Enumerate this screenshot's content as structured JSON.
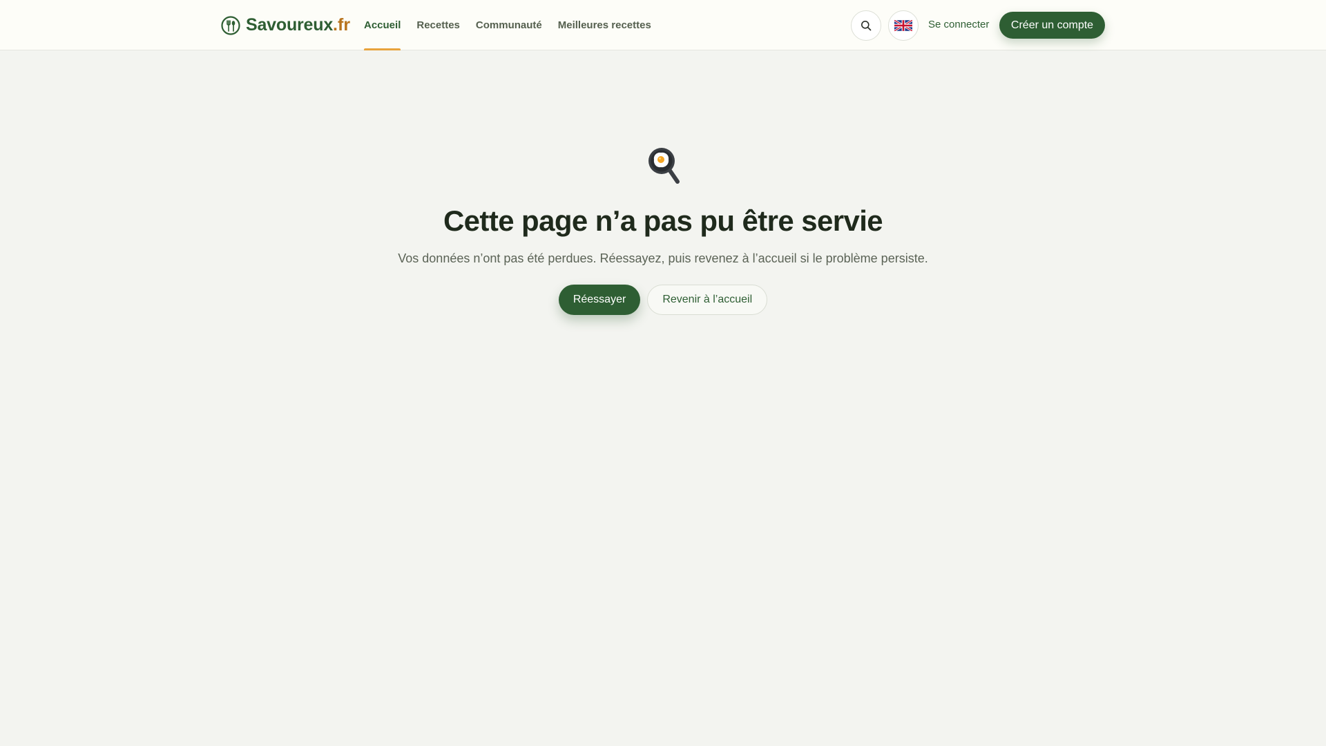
{
  "header": {
    "logo": {
      "name": "Savoureux",
      "tld": ".fr"
    },
    "nav": [
      {
        "label": "Accueil",
        "active": true
      },
      {
        "label": "Recettes",
        "active": false
      },
      {
        "label": "Communauté",
        "active": false
      },
      {
        "label": "Meilleures recettes",
        "active": false
      }
    ],
    "search_icon": "search-icon",
    "language_icon": "uk-flag-icon",
    "login_label": "Se connecter",
    "signup_label": "Créer un compte"
  },
  "error": {
    "icon": "frying-pan-egg-icon",
    "title": "Cette page n’a pas pu être servie",
    "description": "Vos données n’ont pas été perdues. Réessayez, puis revenez à l’accueil si le problème persiste.",
    "retry_label": "Réessayer",
    "home_label": "Revenir à l’accueil"
  },
  "colors": {
    "brand_green": "#2e5e33",
    "accent_orange": "#e8a33c",
    "tld_color": "#b8731c",
    "page_background": "#f3f4f0"
  }
}
